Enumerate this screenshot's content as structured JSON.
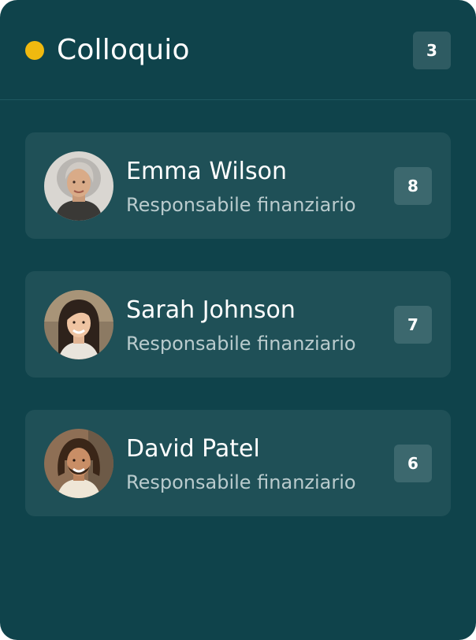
{
  "column": {
    "title": "Colloquio",
    "count": "3",
    "status_color": "#f0b90f"
  },
  "candidates": [
    {
      "name": "Emma Wilson",
      "role": "Responsabile finanziario",
      "score": "8",
      "avatar": "avatar-photo-emma"
    },
    {
      "name": "Sarah Johnson",
      "role": "Responsabile finanziario",
      "score": "7",
      "avatar": "avatar-photo-sarah"
    },
    {
      "name": "David Patel",
      "role": "Responsabile finanziario",
      "score": "6",
      "avatar": "avatar-photo-david"
    }
  ],
  "colors": {
    "background": "#0f434b",
    "card": "#1f5057",
    "badge": "#3c686e"
  }
}
